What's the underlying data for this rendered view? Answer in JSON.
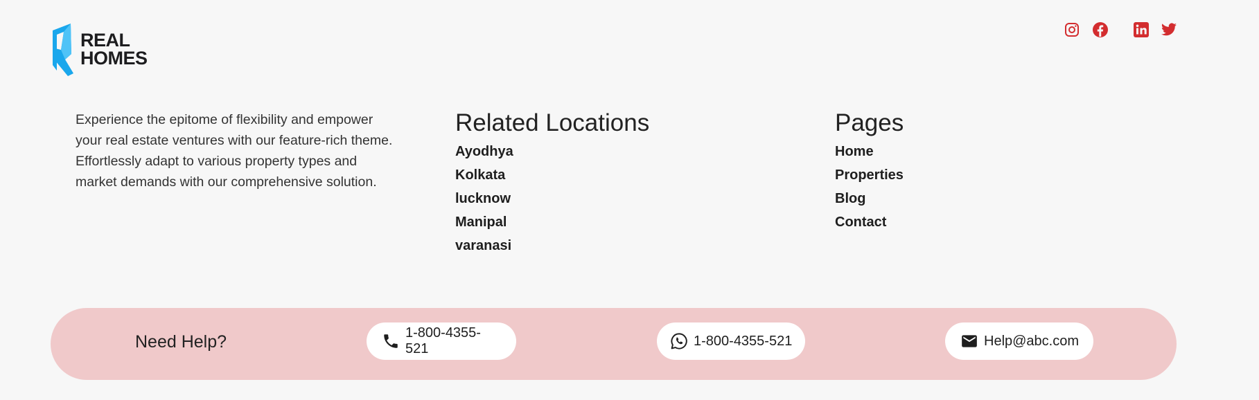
{
  "brand": {
    "line1": "REAL",
    "line2": "HOMES",
    "accent": "#1aa7ec"
  },
  "social": [
    {
      "name": "instagram",
      "icon": "instagram-icon"
    },
    {
      "name": "facebook",
      "icon": "facebook-icon"
    },
    {
      "name": "linkedin",
      "icon": "linkedin-icon"
    },
    {
      "name": "twitter",
      "icon": "twitter-icon"
    }
  ],
  "social_color": "#d32d2f",
  "about": "Experience the epitome of flexibility and empower your real estate ventures with our feature-rich theme. Effortlessly adapt to various property types and market demands with our comprehensive solution.",
  "related": {
    "title": "Related Locations",
    "items": [
      "Ayodhya",
      "Kolkata",
      "lucknow",
      "Manipal",
      "varanasi"
    ]
  },
  "pages": {
    "title": "Pages",
    "items": [
      "Home",
      "Properties",
      "Blog",
      "Contact"
    ]
  },
  "help": {
    "title": "Need Help?",
    "phone": "1-800-4355-521",
    "whatsapp": "1-800-4355-521",
    "email": "Help@abc.com",
    "bar_color": "#f0c9ca"
  }
}
